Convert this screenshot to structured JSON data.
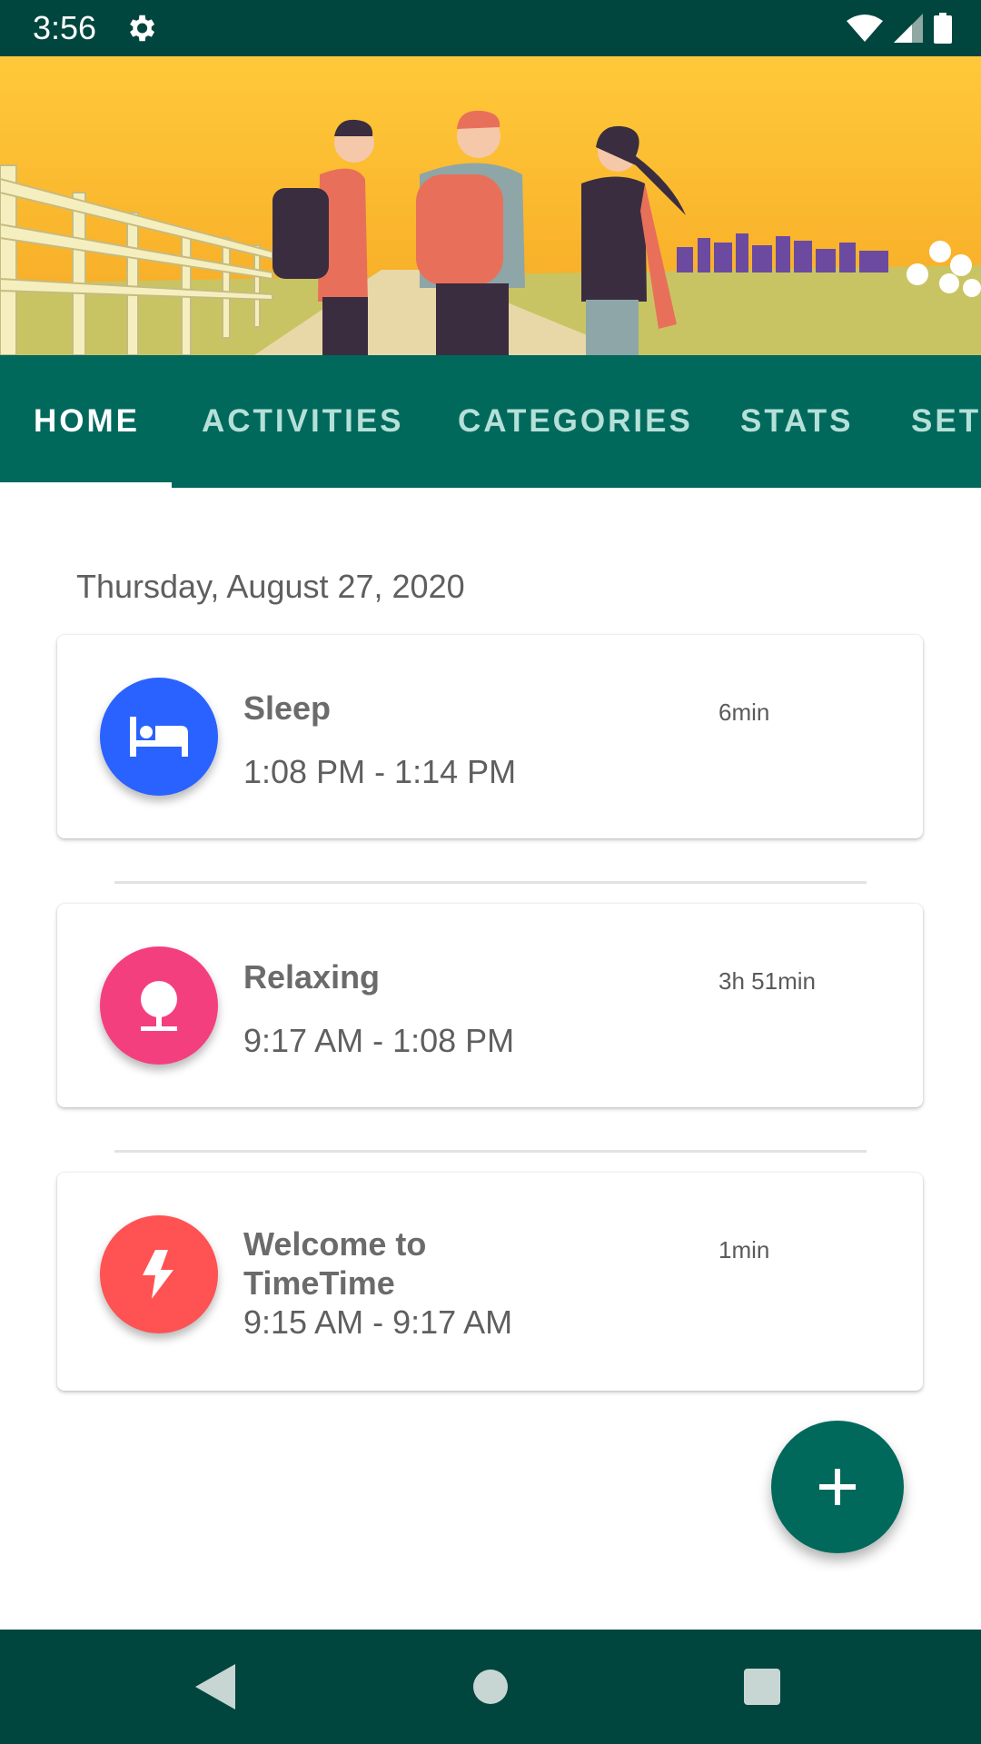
{
  "status_bar": {
    "time": "3:56",
    "icons": [
      "gear-icon",
      "wifi-icon",
      "signal-icon",
      "battery-icon"
    ]
  },
  "tabs": [
    {
      "label": "HOME",
      "active": true
    },
    {
      "label": "ACTIVITIES",
      "active": false
    },
    {
      "label": "CATEGORIES",
      "active": false
    },
    {
      "label": "STATS",
      "active": false
    },
    {
      "label": "SETTINGS",
      "active": false
    }
  ],
  "date_header": "Thursday, August 27, 2020",
  "activities": [
    {
      "title": "Sleep",
      "duration": "6min",
      "time_range": "1:08 PM - 1:14 PM",
      "icon": "bed-icon",
      "color": "#2962ff"
    },
    {
      "title": "Relaxing",
      "duration": "3h 51min",
      "time_range": "9:17 AM - 1:08 PM",
      "icon": "tree-icon",
      "color": "#f43f7f"
    },
    {
      "title": "Welcome to TimeTime",
      "duration": "1min",
      "time_range": "9:15 AM - 9:17 AM",
      "icon": "lightning-icon",
      "color": "#ff5252"
    }
  ],
  "fab": {
    "icon": "plus-icon"
  },
  "colors": {
    "primary": "#00695c",
    "primary_dark": "#00463e"
  }
}
